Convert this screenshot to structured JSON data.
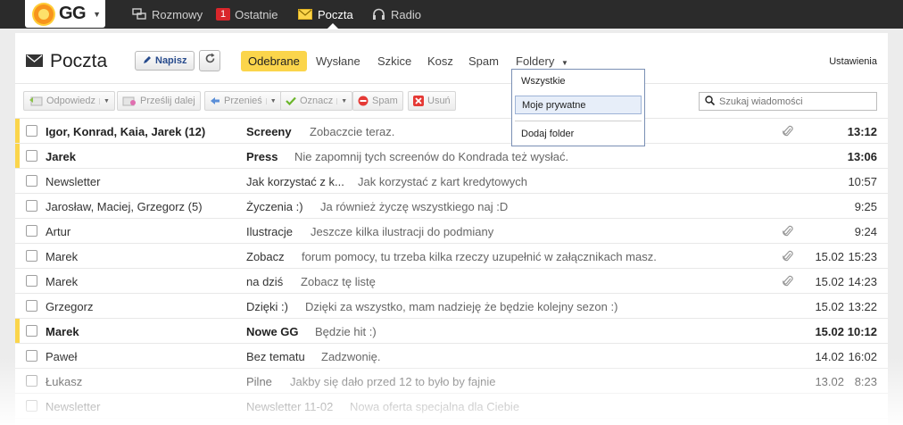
{
  "topbar": {
    "logo_text": "GG",
    "nav": [
      {
        "label": "Rozmowy"
      },
      {
        "label": "Ostatnie",
        "badge": "1"
      },
      {
        "label": "Poczta"
      },
      {
        "label": "Radio"
      }
    ]
  },
  "mail": {
    "title": "Poczta",
    "compose_label": "Napisz",
    "tabs": [
      "Odebrane",
      "Wysłane",
      "Szkice",
      "Kosz",
      "Spam",
      "Foldery"
    ],
    "settings_label": "Ustawienia",
    "toolbar": {
      "reply": "Odpowiedz",
      "forward": "Prześlij dalej",
      "move": "Przenieś",
      "mark": "Oznacz",
      "spam": "Spam",
      "delete": "Usuń"
    },
    "search_placeholder": "Szukaj wiadomości",
    "folders_menu": [
      "Wszystkie",
      "Moje prywatne",
      "Dodaj folder"
    ]
  },
  "messages": [
    {
      "sender": "Igor, Konrad, Kaia, Jarek (12)",
      "subject": "Screeny",
      "preview": "Zobaczcie teraz.",
      "date": "",
      "time": "13:12"
    },
    {
      "sender": "Jarek",
      "subject": "Press",
      "preview": "Nie zapomnij tych screenów do Kondrada też wysłać.",
      "date": "",
      "time": "13:06"
    },
    {
      "sender": "Newsletter",
      "subject": "Jak korzystać z k...",
      "preview": "Jak korzystać z kart kredytowych",
      "date": "",
      "time": "10:57"
    },
    {
      "sender": "Jarosław, Maciej, Grzegorz (5)",
      "subject": "Życzenia :)",
      "preview": "Ja również życzę wszystkiego naj :D",
      "date": "",
      "time": "9:25"
    },
    {
      "sender": "Artur",
      "subject": "Ilustracje",
      "preview": "Jeszcze kilka ilustracji do podmiany",
      "date": "",
      "time": "9:24"
    },
    {
      "sender": "Marek",
      "subject": "Zobacz",
      "preview": "forum pomocy, tu trzeba kilka rzeczy uzupełnić w załącznikach masz.",
      "date": "15.02",
      "time": "15:23"
    },
    {
      "sender": "Marek",
      "subject": "na dziś",
      "preview": "Zobacz tę listę",
      "date": "15.02",
      "time": "14:23"
    },
    {
      "sender": "Grzegorz",
      "subject": "Dzięki :)",
      "preview": "Dzięki za wszystko, mam nadzieję że będzie kolejny sezon :)",
      "date": "15.02",
      "time": "13:22"
    },
    {
      "sender": "Marek",
      "subject": "Nowe GG",
      "preview": "Będzie hit :)",
      "date": "15.02",
      "time": "10:12"
    },
    {
      "sender": "Paweł",
      "subject": "Bez tematu",
      "preview": "Zadzwonię.",
      "date": "14.02",
      "time": "16:02"
    },
    {
      "sender": "Łukasz",
      "subject": "Pilne",
      "preview": "Jakby się dało przed 12 to było by fajnie",
      "date": "13.02",
      "time": "8:23"
    },
    {
      "sender": "Newsletter",
      "subject": "Newsletter 11-02",
      "preview": "Nowa oferta specjalna dla Ciebie",
      "date": "",
      "time": ""
    }
  ],
  "colors": {
    "topbar": "#2b2b2b",
    "accent": "#fbd54b",
    "badge": "#d9262b",
    "menu_border": "#7a8fb4"
  }
}
